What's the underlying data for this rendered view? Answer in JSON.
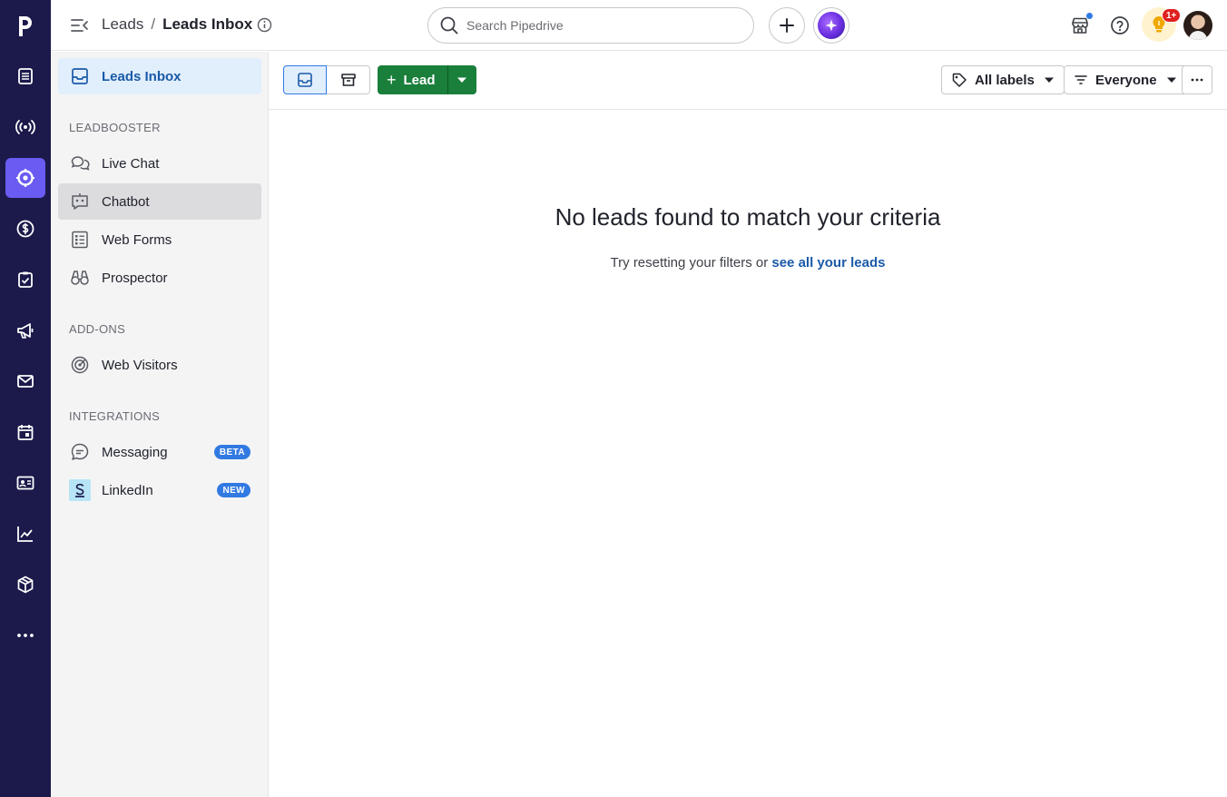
{
  "rail": {
    "logo": "p",
    "items": [
      {
        "icon": "leads-doc-icon"
      },
      {
        "icon": "broadcast-icon"
      },
      {
        "icon": "target-icon",
        "active": true
      },
      {
        "icon": "dollar-icon"
      },
      {
        "icon": "activities-icon"
      },
      {
        "icon": "megaphone-icon"
      },
      {
        "icon": "mail-icon"
      },
      {
        "icon": "calendar-icon"
      },
      {
        "icon": "contacts-icon"
      },
      {
        "icon": "insights-icon"
      },
      {
        "icon": "products-icon"
      },
      {
        "icon": "more-icon"
      }
    ]
  },
  "header": {
    "breadcrumb_parent": "Leads",
    "breadcrumb_sep": "/",
    "breadcrumb_current": "Leads Inbox",
    "search_placeholder": "Search Pipedrive",
    "notification_count": "1+"
  },
  "sidebar": {
    "top_item": "Leads Inbox",
    "sections": [
      {
        "title": "LEADBOOSTER",
        "items": [
          "Live Chat",
          "Chatbot",
          "Web Forms",
          "Prospector"
        ]
      },
      {
        "title": "ADD-ONS",
        "items": [
          "Web Visitors"
        ]
      },
      {
        "title": "INTEGRATIONS",
        "items": [
          "Messaging",
          "LinkedIn"
        ]
      }
    ],
    "badges": {
      "messaging": "BETA",
      "linkedin": "NEW"
    }
  },
  "toolbar": {
    "lead_label": "Lead",
    "labels_filter": "All labels",
    "owner_filter": "Everyone"
  },
  "empty_state": {
    "title": "No leads found to match your criteria",
    "subtitle": "Try resetting your filters or ",
    "link": "see all your leads"
  },
  "colors": {
    "rail_bg": "#1b1a4b",
    "rail_active": "#6a5cf2",
    "primary_green": "#1a7f3b",
    "link_blue": "#1a5aa8",
    "badge_blue": "#317ae2"
  }
}
